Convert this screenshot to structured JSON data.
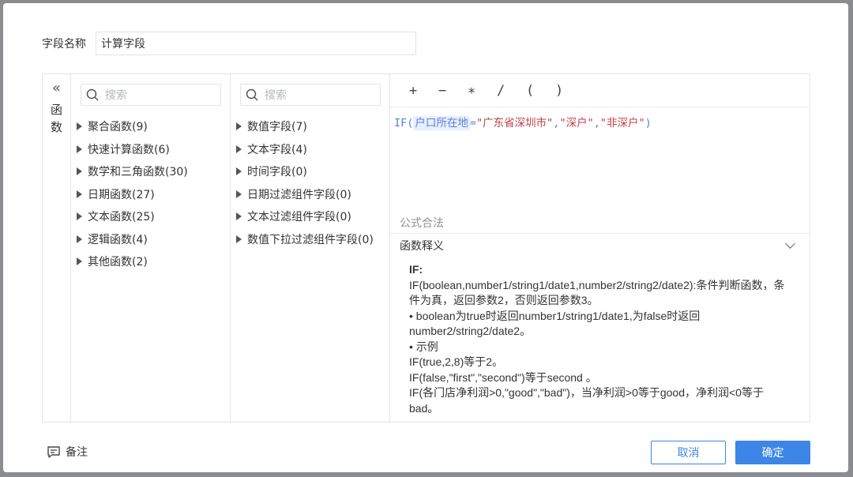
{
  "field": {
    "label": "字段名称",
    "value": "计算字段"
  },
  "sidebar": {
    "collapse_glyph": "«",
    "vertical_label": "函数"
  },
  "functions": {
    "search_placeholder": "搜索",
    "items": [
      "聚合函数(9)",
      "快速计算函数(6)",
      "数学和三角函数(30)",
      "日期函数(27)",
      "文本函数(25)",
      "逻辑函数(4)",
      "其他函数(2)"
    ]
  },
  "fields": {
    "search_placeholder": "搜索",
    "items": [
      "数值字段(7)",
      "文本字段(4)",
      "时间字段(0)",
      "日期过滤组件字段(0)",
      "文本过滤组件字段(0)",
      "数值下拉过滤组件字段(0)"
    ]
  },
  "operators": [
    "+",
    "−",
    "∗",
    "/",
    "(",
    ")"
  ],
  "formula": {
    "prefix": "IF(",
    "field_chip": "户口所在地",
    "op": "=",
    "str1": "\"广东省深圳市\"",
    "comma1": ",",
    "str2": "\"深户\"",
    "comma2": ",",
    "str3": "\"非深户\"",
    "suffix": ")"
  },
  "validation": "公式合法",
  "explain": {
    "header": "函数释义",
    "name": "IF:",
    "lines": [
      "IF(boolean,number1/string1/date1,number2/string2/date2):条件判断函数，条件为真，返回参数2，否则返回参数3。",
      "• boolean为true时返回number1/string1/date1,为false时返回number2/string2/date2。",
      "• 示例",
      "IF(true,2,8)等于2。",
      "IF(false,\"first\",\"second\")等于second 。",
      "IF(各门店净利润>0,\"good\",\"bad\")，当净利润>0等于good，净利润<0等于bad。"
    ]
  },
  "footer": {
    "note": "备注",
    "cancel": "取消",
    "ok": "确定"
  },
  "colors": {
    "accent": "#3d85e6",
    "formula_blue": "#5b7fd6",
    "string_red": "#c0404a"
  }
}
